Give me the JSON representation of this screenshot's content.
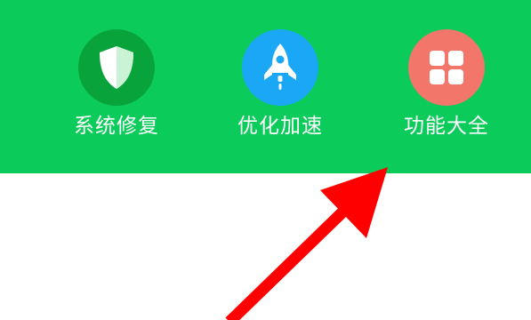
{
  "tools": [
    {
      "label": "系统修复",
      "icon": "shield-icon",
      "color": "#09a33b"
    },
    {
      "label": "优化加速",
      "icon": "rocket-icon",
      "color": "#1aa7f5"
    },
    {
      "label": "功能大全",
      "icon": "grid-icon",
      "color": "#f2776a"
    }
  ],
  "toolbar_color": "#0bcb5a",
  "annotation": {
    "icon": "red-arrow-icon",
    "color": "#ff0000"
  }
}
